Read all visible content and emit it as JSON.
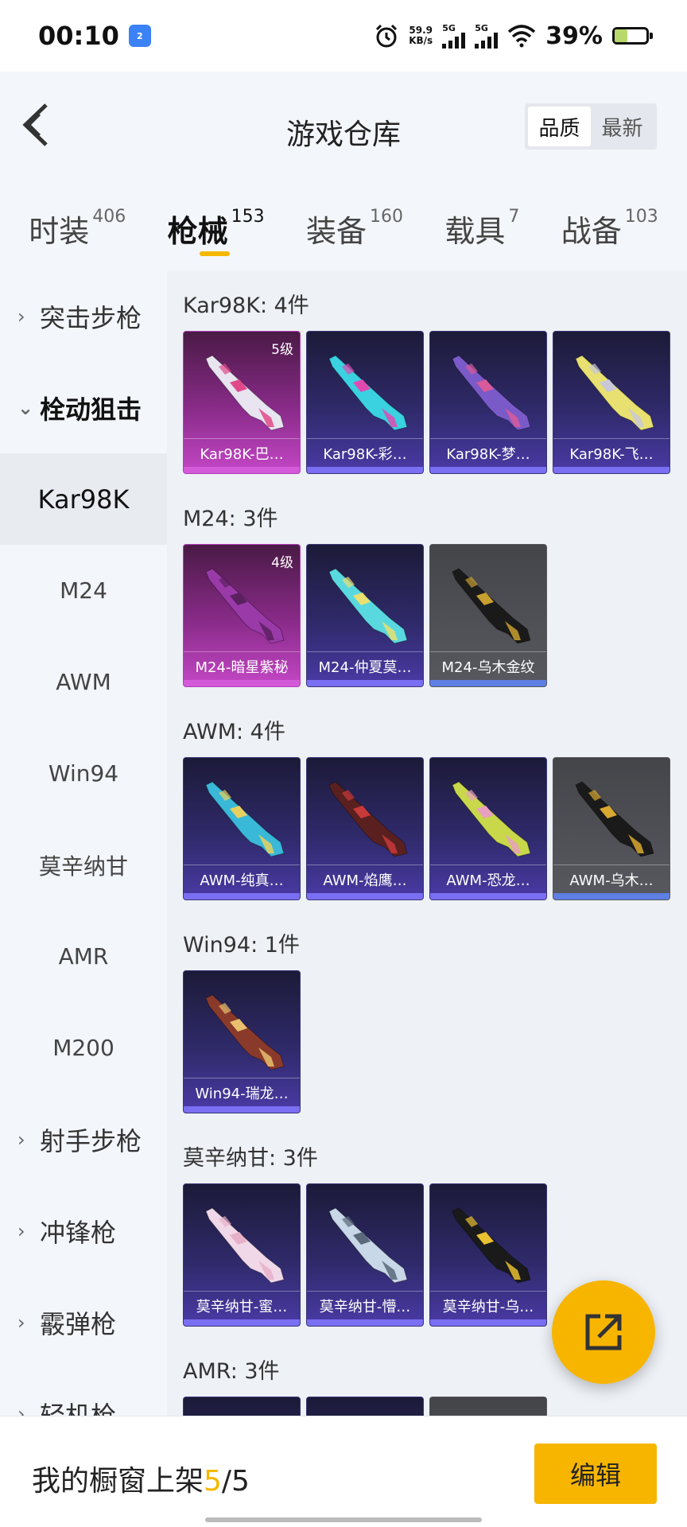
{
  "status_bar": {
    "time": "00:10",
    "nfc_badge": "2",
    "net_speed_value": "59.9",
    "net_speed_unit": "KB/s",
    "sim1_label": "5G",
    "sim2_label": "5G",
    "battery_percent": "39%",
    "battery_level": 0.39
  },
  "header": {
    "title": "游戏仓库",
    "sort_options": [
      "品质",
      "最新"
    ],
    "sort_selected": "品质"
  },
  "category_tabs": [
    {
      "label": "时装",
      "count": "406"
    },
    {
      "label": "枪械",
      "count": "153",
      "active": true
    },
    {
      "label": "装备",
      "count": "160"
    },
    {
      "label": "载具",
      "count": "7"
    },
    {
      "label": "战备",
      "count": "103"
    }
  ],
  "sidebar": {
    "items": [
      {
        "label": "突击步枪",
        "type": "group"
      },
      {
        "label": "栓动狙击",
        "type": "group",
        "open": true
      },
      {
        "label": "Kar98K",
        "type": "sub",
        "selected": true
      },
      {
        "label": "M24",
        "type": "sub"
      },
      {
        "label": "AWM",
        "type": "sub"
      },
      {
        "label": "Win94",
        "type": "sub"
      },
      {
        "label": "莫辛纳甘",
        "type": "sub"
      },
      {
        "label": "AMR",
        "type": "sub"
      },
      {
        "label": "M200",
        "type": "sub"
      },
      {
        "label": "射手步枪",
        "type": "group"
      },
      {
        "label": "冲锋枪",
        "type": "group"
      },
      {
        "label": "霰弹枪",
        "type": "group"
      },
      {
        "label": "轻机枪",
        "type": "group"
      }
    ]
  },
  "sections": [
    {
      "title": "Kar98K: 4件",
      "items": [
        {
          "name": "Kar98K-巴…",
          "tier": "pink",
          "level": "5级",
          "gun_color": "#e8e4f0",
          "accent": "#e04a8a"
        },
        {
          "name": "Kar98K-彩…",
          "tier": "purple",
          "gun_color": "#3ad1e0",
          "accent": "#e04ab0"
        },
        {
          "name": "Kar98K-梦…",
          "tier": "purple",
          "gun_color": "#7a5ac8",
          "accent": "#d85a9a"
        },
        {
          "name": "Kar98K-飞…",
          "tier": "purple",
          "gun_color": "#e8e070",
          "accent": "#c8c8d8"
        }
      ]
    },
    {
      "title": "M24: 3件",
      "items": [
        {
          "name": "M24-暗星紫秘",
          "tier": "pink",
          "level": "4级",
          "gun_color": "#9a3aa8",
          "accent": "#5a2060"
        },
        {
          "name": "M24-仲夏莫…",
          "tier": "purple",
          "gun_color": "#5ad8e0",
          "accent": "#e8e070"
        },
        {
          "name": "M24-乌木金纹",
          "tier": "grey",
          "gun_color": "#1a1a1a",
          "accent": "#c8a030"
        }
      ]
    },
    {
      "title": "AWM: 4件",
      "items": [
        {
          "name": "AWM-纯真…",
          "tier": "purple",
          "gun_color": "#3ab8d8",
          "accent": "#e8d060"
        },
        {
          "name": "AWM-焰鹰…",
          "tier": "purple",
          "gun_color": "#5a2020",
          "accent": "#c83a3a"
        },
        {
          "name": "AWM-恐龙…",
          "tier": "purple",
          "gun_color": "#c8d84a",
          "accent": "#e8a0c0"
        },
        {
          "name": "AWM-乌木…",
          "tier": "grey",
          "gun_color": "#1a1a1a",
          "accent": "#d8a830"
        }
      ]
    },
    {
      "title": "Win94: 1件",
      "items": [
        {
          "name": "Win94-瑞龙…",
          "tier": "purple",
          "gun_color": "#8a3a2a",
          "accent": "#e8c070"
        }
      ]
    },
    {
      "title": "莫辛纳甘: 3件",
      "items": [
        {
          "name": "莫辛纳甘-蜜…",
          "tier": "purple",
          "gun_color": "#f0d8e8",
          "accent": "#e8b0c8"
        },
        {
          "name": "莫辛纳甘-懵…",
          "tier": "purple",
          "gun_color": "#c8d8e8",
          "accent": "#5a6a7a"
        },
        {
          "name": "莫辛纳甘-乌…",
          "tier": "purple",
          "gun_color": "#1a1a1a",
          "accent": "#e8c030"
        }
      ]
    },
    {
      "title": "AMR: 3件",
      "items": [
        {
          "name": "",
          "tier": "purple",
          "gun_color": "#e8d8c8",
          "accent": "#c8a070"
        },
        {
          "name": "",
          "tier": "purple",
          "gun_color": "#c84a4a",
          "accent": "#e8c0a0"
        },
        {
          "name": "",
          "tier": "grey",
          "gun_color": "#2a2a2a",
          "accent": "#c8a030"
        }
      ]
    }
  ],
  "bottom_panel": {
    "showcase_label": "我的橱窗上架",
    "showcase_count": "5",
    "showcase_total": "/5",
    "edit_label": "编辑"
  },
  "colors": {
    "accent": "#f5b800",
    "card_purple": "#3a3577",
    "card_pink": "#c447c6",
    "card_grey": "#58595f"
  }
}
